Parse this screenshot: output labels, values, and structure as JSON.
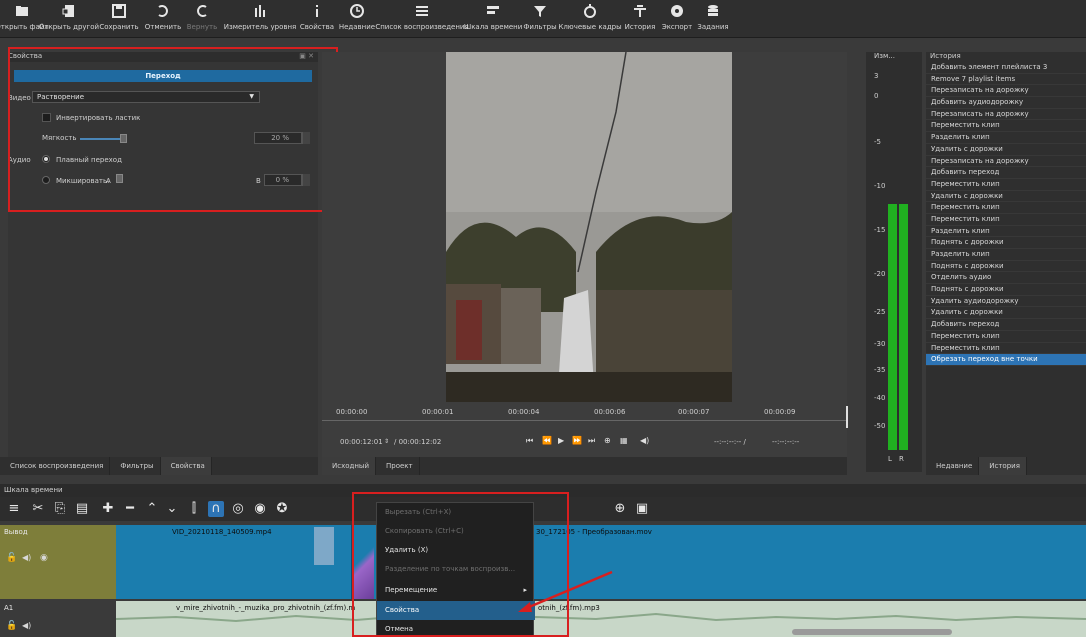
{
  "toolbar": {
    "items": [
      {
        "label": "Открыть файл",
        "icon": "folder-open-icon"
      },
      {
        "label": "Открыть другой",
        "icon": "open-other-icon"
      },
      {
        "label": "Сохранить",
        "icon": "save-icon"
      },
      {
        "label": "Отменить",
        "icon": "undo-icon"
      },
      {
        "label": "Вернуть",
        "icon": "redo-icon",
        "disabled": true
      },
      {
        "label": "Измеритель уровня",
        "icon": "level-meter-icon"
      },
      {
        "label": "Свойства",
        "icon": "info-icon"
      },
      {
        "label": "Недавние",
        "icon": "clock-icon"
      },
      {
        "label": "Список воспроизведения",
        "icon": "playlist-icon"
      },
      {
        "label": "Шкала времени",
        "icon": "timeline-icon"
      },
      {
        "label": "Фильтры",
        "icon": "filter-icon"
      },
      {
        "label": "Ключевые кадры",
        "icon": "keyframes-icon"
      },
      {
        "label": "История",
        "icon": "history-icon"
      },
      {
        "label": "Экспорт",
        "icon": "export-icon"
      },
      {
        "label": "Задания",
        "icon": "jobs-icon"
      }
    ]
  },
  "properties": {
    "title": "Свойства",
    "transition_label": "Переход",
    "video_label": "Видео",
    "video_select": "Растворение",
    "invert_label": "Инвертировать ластик",
    "softness_label": "Мягкость",
    "softness_value": "20 %",
    "audio_label": "Аудио",
    "crossfade_label": "Плавный переход",
    "mix_label": "Микшировать:",
    "mix_a": "A",
    "mix_b": "B",
    "mix_value": "0 %",
    "softness_fraction": 0.2,
    "mix_fraction": 0.0
  },
  "left_tabs": [
    "Список воспроизведения",
    "Фильтры",
    "Свойства"
  ],
  "player": {
    "ruler": [
      "00:00:00",
      "00:00:01",
      "00:00:04",
      "00:00:06",
      "00:00:07",
      "00:00:09"
    ],
    "timecode_current": "00:00:12:01",
    "timecode_total": "/ 00:00:12:02",
    "in_point": "--:--:--:-- /",
    "out_point": "--:--:--:--",
    "tabs": [
      "Исходный",
      "Проект"
    ]
  },
  "meters": {
    "header": "Изм...",
    "scale": [
      "3",
      "0",
      "-5",
      "-10",
      "-15",
      "-20",
      "-25",
      "-30",
      "-35",
      "-40",
      "-50"
    ],
    "channels": [
      "L",
      "R"
    ],
    "levels_db": [
      -17,
      -17
    ]
  },
  "history": {
    "title": "История",
    "items": [
      "Добавить элемент плейлиста 3",
      "Remove 7 playlist items",
      "Перезаписать на дорожку",
      "Добавить аудиодорожку",
      "Перезаписать на дорожку",
      "Переместить клип",
      "Разделить клип",
      "Удалить с дорожки",
      "Перезаписать на дорожку",
      "Добавить переход",
      "Переместить клип",
      "Удалить с дорожки",
      "Переместить клип",
      "Переместить клип",
      "Разделить клип",
      "Поднять с дорожки",
      "Разделить клип",
      "Поднять с дорожки",
      "Отделить аудио",
      "Поднять с дорожки",
      "Удалить аудиодорожку",
      "Удалить с дорожки",
      "Добавить переход",
      "Переместить клип",
      "Переместить клип",
      "Обрезать переход вне точки"
    ],
    "selected_index": 25,
    "tabs": [
      "Недавние",
      "История"
    ]
  },
  "timeline": {
    "title": "Шкала времени",
    "tracks": {
      "video_name": "Вывод",
      "audio_name": "A1"
    },
    "clips": {
      "video_1": "VID_20210118_140509.mp4",
      "video_2": "30_172105 - Преобразован.mov",
      "audio_1": "v_mire_zhivotnih_-_muzika_pro_zhivotnih_(zf.fm).m",
      "audio_2": "otnih_(zf.fm).mp3"
    }
  },
  "context_menu": {
    "items": [
      {
        "label": "Вырезать (Ctrl+X)",
        "disabled": true
      },
      {
        "label": "Скопировать (Ctrl+C)",
        "disabled": true
      },
      {
        "label": "Удалить (X)",
        "disabled": false
      },
      {
        "label": "Разделение по точкам воспроизв...",
        "disabled": true
      },
      {
        "label": "Перемещение",
        "disabled": false,
        "submenu": true
      },
      {
        "label": "Свойства",
        "disabled": false,
        "highlight": true
      },
      {
        "label": "Отмена",
        "disabled": false
      }
    ],
    "submenu_arrow": "▸"
  },
  "colors": {
    "accent": "#1f6aa0",
    "selection": "#2d74b5",
    "annotation_red": "#d81f1f",
    "video_track": "#1b7dae",
    "meter_green": "#20b020"
  }
}
